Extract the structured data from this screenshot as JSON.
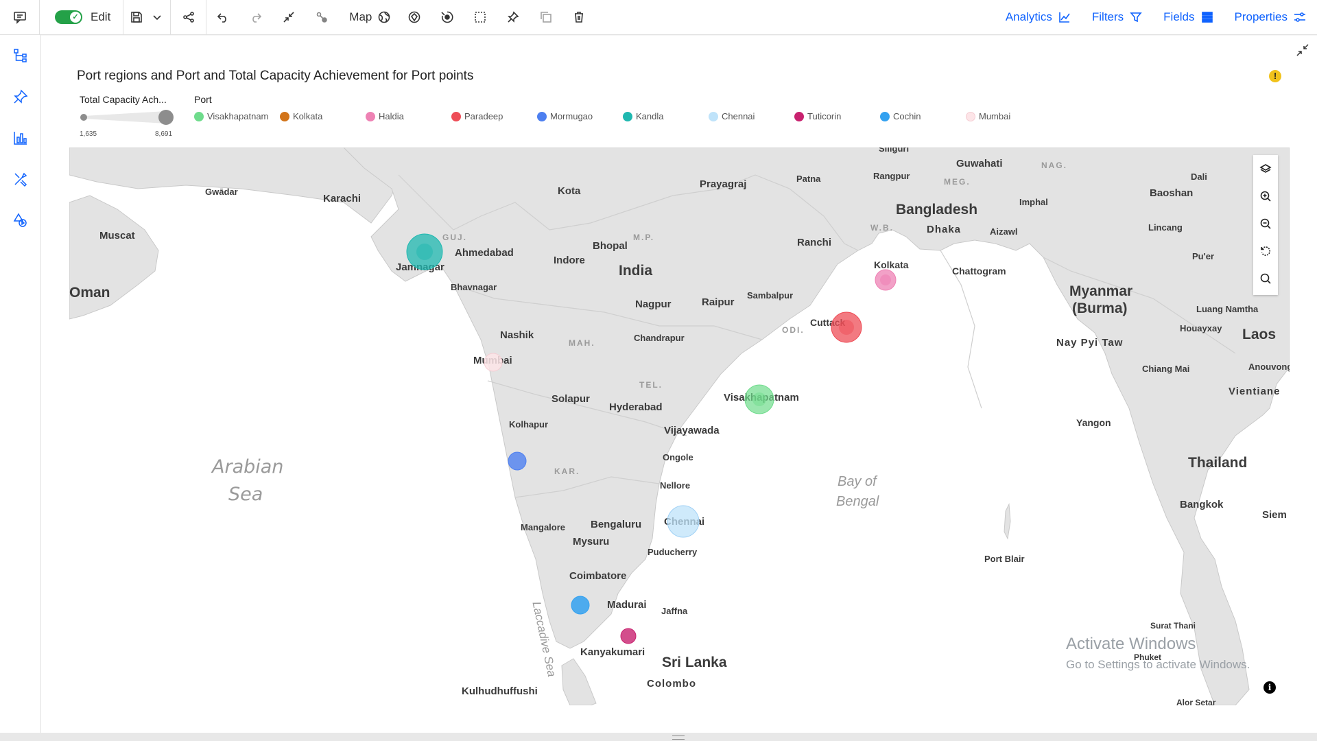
{
  "toolbar": {
    "edit_label": "Edit",
    "map_label": "Map",
    "right": [
      {
        "label": "Analytics",
        "icon": "analytics-icon"
      },
      {
        "label": "Filters",
        "icon": "filter-icon"
      },
      {
        "label": "Fields",
        "icon": "fields-icon"
      },
      {
        "label": "Properties",
        "icon": "properties-icon"
      }
    ]
  },
  "sidebar": {
    "items": [
      "hierarchy-icon",
      "pin-icon",
      "chart-icon",
      "tools-icon",
      "shapes-icon"
    ]
  },
  "viz": {
    "title": "Port regions and Port and Total Capacity Achievement for Port points",
    "size_legend": {
      "title": "Total Capacity Ach...",
      "min": "1,635",
      "max": "8,691"
    },
    "port_legend": {
      "title": "Port",
      "items": [
        {
          "label": "Visakhapatnam",
          "color": "#6fdc8c"
        },
        {
          "label": "Kolkata",
          "color": "#d2741a"
        },
        {
          "label": "Haldia",
          "color": "#ee82b4"
        },
        {
          "label": "Paradeep",
          "color": "#ee4d57"
        },
        {
          "label": "Mormugao",
          "color": "#4d7ff0"
        },
        {
          "label": "Kandla",
          "color": "#1fb8b0"
        },
        {
          "label": "Chennai",
          "color": "#bfe3fa"
        },
        {
          "label": "Tuticorin",
          "color": "#c8226f"
        },
        {
          "label": "Cochin",
          "color": "#33a1f0"
        },
        {
          "label": "Mumbai",
          "color": "#fde5e8"
        }
      ]
    }
  },
  "map": {
    "places": [
      {
        "name": "Gwādar",
        "size": "s"
      },
      {
        "name": "Karachi",
        "size": "m"
      },
      {
        "name": "Muscat",
        "size": "m"
      },
      {
        "name": "Oman",
        "size": "l"
      },
      {
        "name": "Kota",
        "size": "m"
      },
      {
        "name": "Prayagraj",
        "size": "m"
      },
      {
        "name": "Patna",
        "size": "s"
      },
      {
        "name": "Siliguri",
        "size": "s"
      },
      {
        "name": "Guwahati",
        "size": "m"
      },
      {
        "name": "Rangpur",
        "size": "s"
      },
      {
        "name": "MEG.",
        "size": "s"
      },
      {
        "name": "NAG.",
        "size": "s"
      },
      {
        "name": "Dali",
        "size": "s"
      },
      {
        "name": "Baoshan",
        "size": "m"
      },
      {
        "name": "Imphal",
        "size": "s"
      },
      {
        "name": "Bangladesh",
        "size": "l"
      },
      {
        "name": "W.B.",
        "size": "s"
      },
      {
        "name": "Dhaka",
        "size": "m"
      },
      {
        "name": "Aizawl",
        "size": "s"
      },
      {
        "name": "Lincang",
        "size": "s"
      },
      {
        "name": "GUJ.",
        "size": "s"
      },
      {
        "name": "Ahmedabad",
        "size": "m"
      },
      {
        "name": "Jamnagar",
        "size": "m"
      },
      {
        "name": "Bhopal",
        "size": "m"
      },
      {
        "name": "M.P.",
        "size": "s"
      },
      {
        "name": "Indore",
        "size": "m"
      },
      {
        "name": "India",
        "size": "xl"
      },
      {
        "name": "Ranchi",
        "size": "m"
      },
      {
        "name": "Kolkata",
        "size": "m"
      },
      {
        "name": "Chattogram",
        "size": "m"
      },
      {
        "name": "Pu'er",
        "size": "s"
      },
      {
        "name": "Myanmar",
        "size": "l"
      },
      {
        "name": "(Burma)",
        "size": "l"
      },
      {
        "name": "Bhavnagar",
        "size": "s"
      },
      {
        "name": "Nagpur",
        "size": "m"
      },
      {
        "name": "Raipur",
        "size": "m"
      },
      {
        "name": "Sambalpur",
        "size": "s"
      },
      {
        "name": "Luang Namtha",
        "size": "s"
      },
      {
        "name": "Cuttack",
        "size": "m"
      },
      {
        "name": "ODI.",
        "size": "s"
      },
      {
        "name": "Houayxay",
        "size": "s"
      },
      {
        "name": "Nashik",
        "size": "m"
      },
      {
        "name": "MAH.",
        "size": "s"
      },
      {
        "name": "Chandrapur",
        "size": "s"
      },
      {
        "name": "Nay Pyi Taw",
        "size": "m"
      },
      {
        "name": "Laos",
        "size": "l"
      },
      {
        "name": "Mumbai",
        "size": "m"
      },
      {
        "name": "Chiang Mai",
        "size": "s"
      },
      {
        "name": "Anouvong",
        "size": "s"
      },
      {
        "name": "TEL.",
        "size": "s"
      },
      {
        "name": "Solapur",
        "size": "m"
      },
      {
        "name": "Visakhapatnam",
        "size": "m"
      },
      {
        "name": "Vientiane",
        "size": "m"
      },
      {
        "name": "Hyderabad",
        "size": "m"
      },
      {
        "name": "Kolhapur",
        "size": "s"
      },
      {
        "name": "Yangon",
        "size": "m"
      },
      {
        "name": "Vijayawada",
        "size": "m"
      },
      {
        "name": "Ongole",
        "size": "s"
      },
      {
        "name": "Thailand",
        "size": "l"
      },
      {
        "name": "KAR.",
        "size": "s"
      },
      {
        "name": "Nellore",
        "size": "s"
      },
      {
        "name": "Bangkok",
        "size": "m"
      },
      {
        "name": "Siem",
        "size": "m"
      },
      {
        "name": "Mangalore",
        "size": "s"
      },
      {
        "name": "Bengaluru",
        "size": "m"
      },
      {
        "name": "Chennai",
        "size": "m"
      },
      {
        "name": "Mysuru",
        "size": "m"
      },
      {
        "name": "Puducherry",
        "size": "s"
      },
      {
        "name": "Port Blair",
        "size": "s"
      },
      {
        "name": "Coimbatore",
        "size": "m"
      },
      {
        "name": "Madurai",
        "size": "m"
      },
      {
        "name": "Jaffna",
        "size": "s"
      },
      {
        "name": "Surat Thani",
        "size": "s"
      },
      {
        "name": "Kanyakumari",
        "size": "m"
      },
      {
        "name": "Sri Lanka",
        "size": "l"
      },
      {
        "name": "Phuket",
        "size": "s"
      },
      {
        "name": "Colombo",
        "size": "m"
      },
      {
        "name": "Kulhudhuffushi",
        "size": "m"
      },
      {
        "name": "Alor Setar",
        "size": "s"
      }
    ],
    "sea_labels": {
      "arabian_1": "Arabian",
      "arabian_2": "Sea",
      "bengal_1": "Bay of",
      "bengal_2": "Bengal",
      "laccadive": "Laccadive Sea"
    }
  },
  "watermark": {
    "line1": "Activate Windows",
    "line2": "Go to Settings to activate Windows."
  }
}
